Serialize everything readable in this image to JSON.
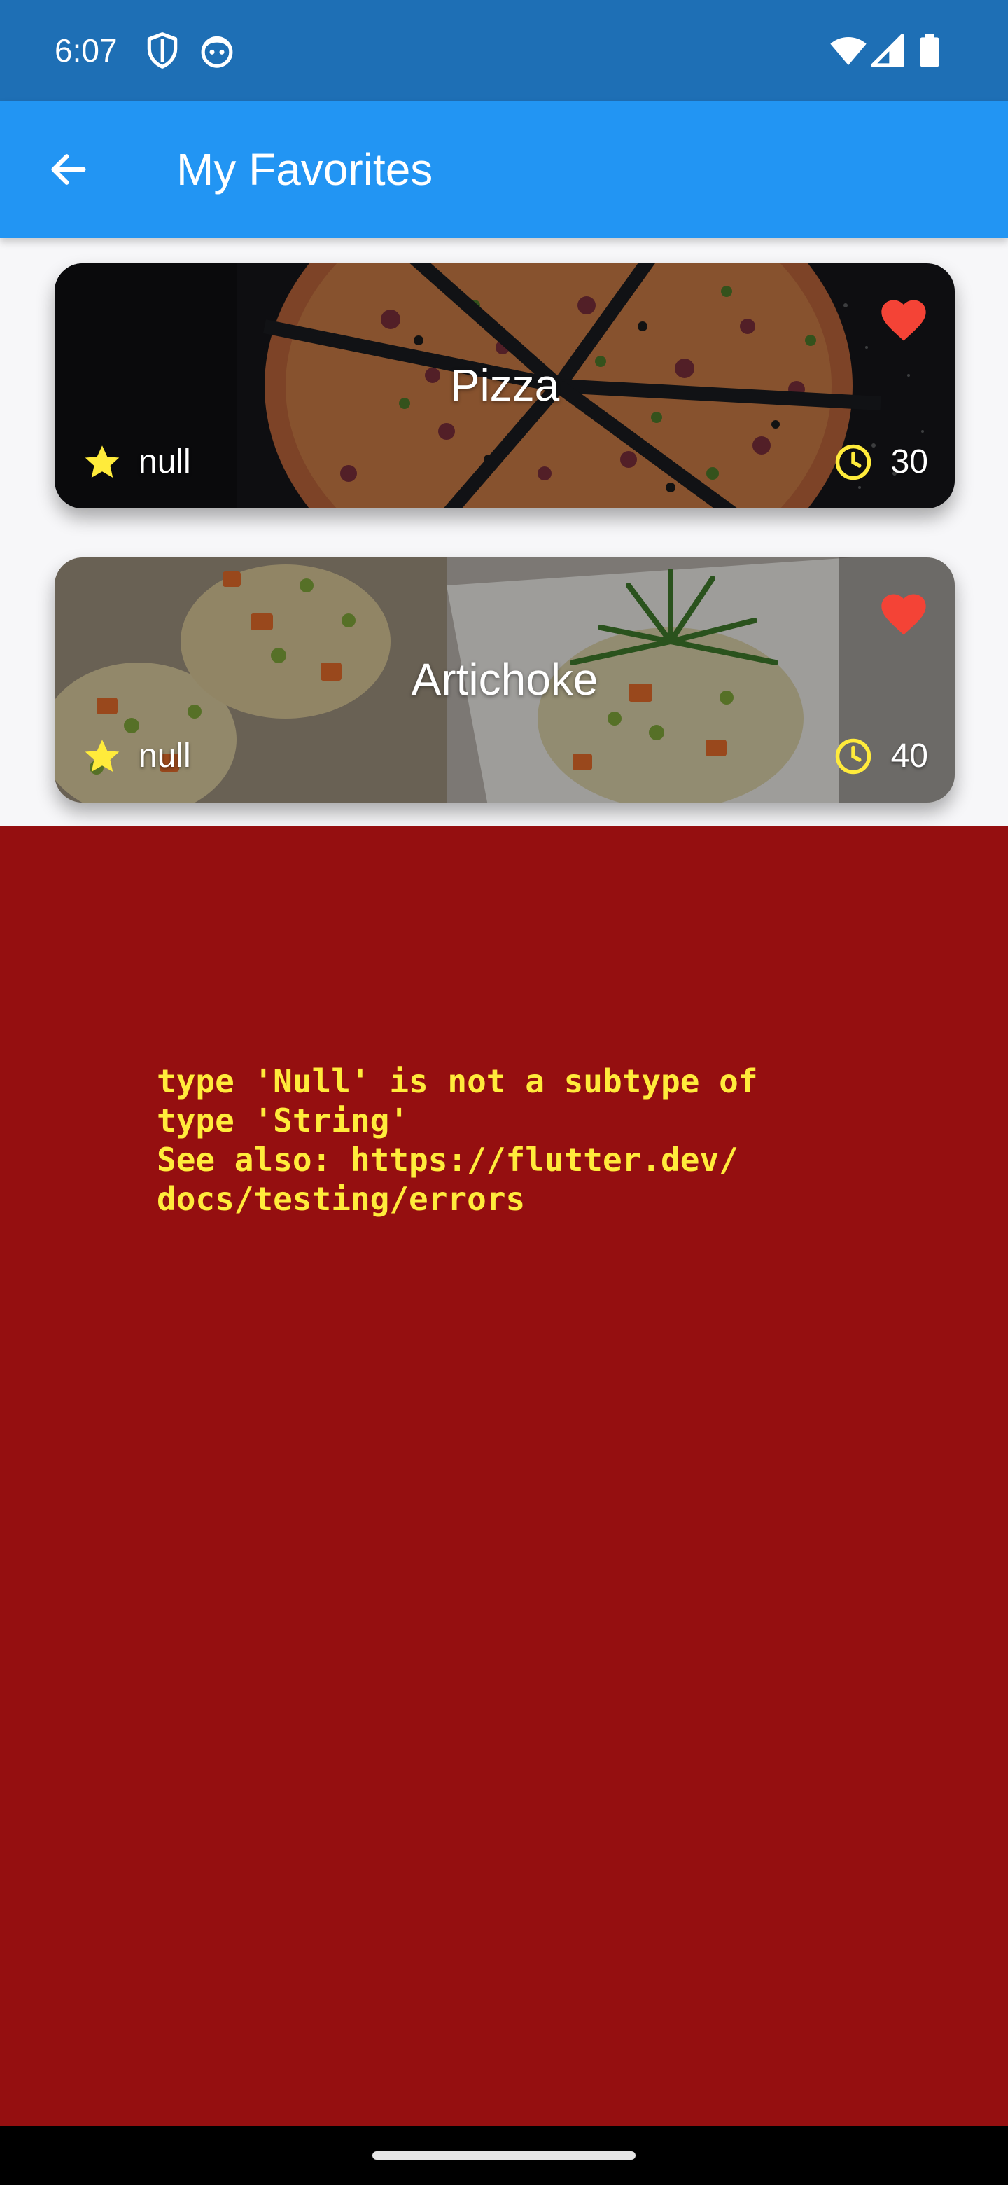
{
  "status_bar": {
    "time": "6:07",
    "icons": [
      "shield-icon",
      "face-icon",
      "wifi-icon",
      "cellular-icon",
      "battery-icon"
    ]
  },
  "app_bar": {
    "title": "My Favorites",
    "back_icon": "arrow-left-icon",
    "background_color": "#2295f3"
  },
  "favorites": [
    {
      "title": "Pizza",
      "rating": "null",
      "duration": "30",
      "favorite": true
    },
    {
      "title": "Artichoke",
      "rating": "null",
      "duration": "40",
      "favorite": true
    }
  ],
  "error": {
    "message": "type 'Null' is not a subtype of\ntype 'String'\nSee also: https://flutter.dev/\ndocs/testing/errors",
    "background_color": "#950f10",
    "text_color": "#ffeb3b"
  },
  "colors": {
    "status_bar": "#1e6fb5",
    "heart": "#f44336",
    "accent_yellow": "#ffeb3b"
  }
}
